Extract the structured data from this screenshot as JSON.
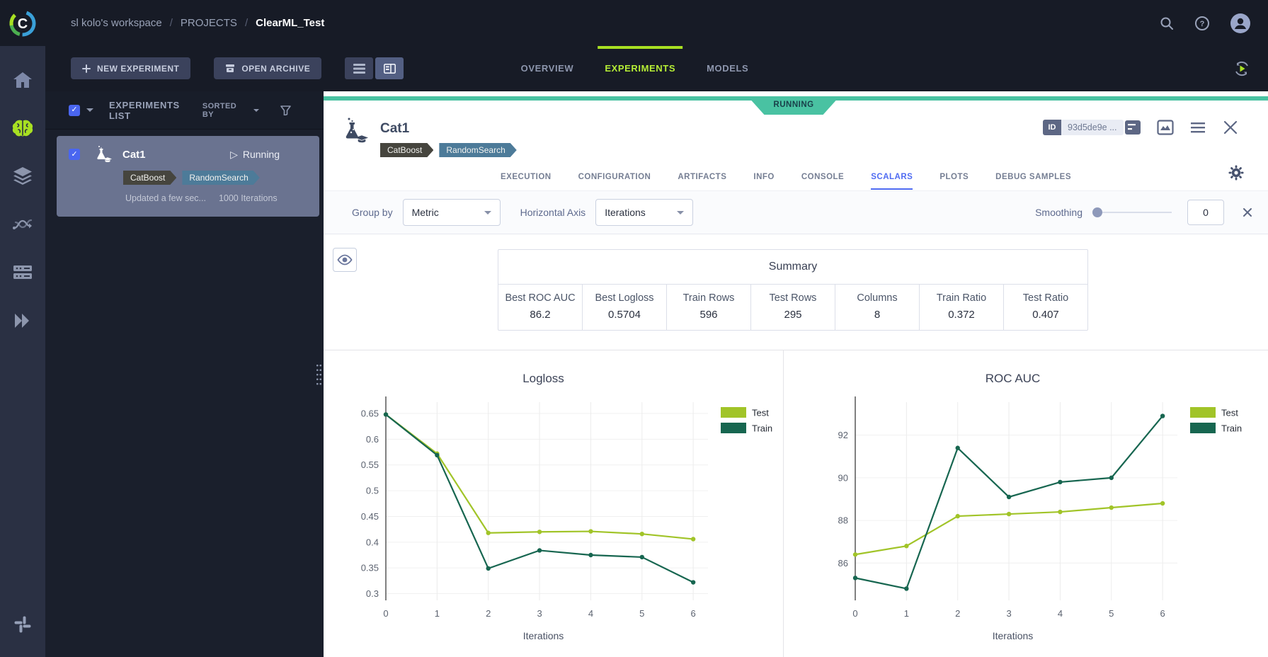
{
  "topbar": {
    "breadcrumb": [
      "sl kolo's workspace",
      "PROJECTS",
      "ClearML_Test"
    ],
    "separator": "/"
  },
  "subbar": {
    "new_experiment": "NEW EXPERIMENT",
    "open_archive": "OPEN ARCHIVE",
    "tabs": [
      "OVERVIEW",
      "EXPERIMENTS",
      "MODELS"
    ],
    "active_tab": "EXPERIMENTS"
  },
  "sidebar": {
    "icons": [
      "home",
      "projects",
      "datasets",
      "pipelines",
      "workers",
      "applications",
      "slack"
    ]
  },
  "experiments_panel": {
    "title": "EXPERIMENTS LIST",
    "sorted_by": "SORTED BY",
    "card": {
      "name": "Cat1",
      "status_icon": "▷",
      "status": "Running",
      "tags": [
        "CatBoost",
        "RandomSearch"
      ],
      "updated": "Updated a few sec...",
      "iterations": "1000 Iterations"
    }
  },
  "detail": {
    "ribbon": "RUNNING",
    "title": "Cat1",
    "tags": [
      "CatBoost",
      "RandomSearch"
    ],
    "id_label": "ID",
    "id_value": "93d5de9e ...",
    "tabs": [
      "EXECUTION",
      "CONFIGURATION",
      "ARTIFACTS",
      "INFO",
      "CONSOLE",
      "SCALARS",
      "PLOTS",
      "DEBUG SAMPLES"
    ],
    "active_tab": "SCALARS",
    "controls": {
      "group_by_label": "Group by",
      "group_by_value": "Metric",
      "horizontal_axis_label": "Horizontal Axis",
      "horizontal_axis_value": "Iterations",
      "smoothing_label": "Smoothing",
      "smoothing_value": "0"
    },
    "summary": {
      "title": "Summary",
      "metrics": [
        {
          "label": "Best ROC AUC",
          "value": "86.2"
        },
        {
          "label": "Best Logloss",
          "value": "0.5704"
        },
        {
          "label": "Train Rows",
          "value": "596"
        },
        {
          "label": "Test Rows",
          "value": "295"
        },
        {
          "label": "Columns",
          "value": "8"
        },
        {
          "label": "Train Ratio",
          "value": "0.372"
        },
        {
          "label": "Test Ratio",
          "value": "0.407"
        }
      ]
    }
  },
  "colors": {
    "accent_lime": "#a8e022",
    "running_teal": "#49c2a2",
    "active_blue": "#4f6bf2",
    "test_series": "#a1c428",
    "train_series": "#176650"
  },
  "chart_data": [
    {
      "type": "line",
      "title": "Logloss",
      "xlabel": "Iterations",
      "x": [
        0,
        1,
        2,
        3,
        4,
        5,
        6
      ],
      "xlim": [
        0,
        6.15
      ],
      "ylim": [
        0.287,
        0.672
      ],
      "yticks": [
        "0.3",
        "0.35",
        "0.4",
        "0.45",
        "0.5",
        "0.55",
        "0.6",
        "0.65"
      ],
      "grid": true,
      "legend_position": "top-right",
      "series": [
        {
          "name": "Test",
          "color": "#a1c428",
          "values": [
            0.648,
            0.572,
            0.418,
            0.42,
            0.421,
            0.416,
            0.406
          ]
        },
        {
          "name": "Train",
          "color": "#176650",
          "values": [
            0.648,
            0.569,
            0.349,
            0.384,
            0.375,
            0.371,
            0.322
          ]
        }
      ]
    },
    {
      "type": "line",
      "title": "ROC AUC",
      "xlabel": "Iterations",
      "x": [
        0,
        1,
        2,
        3,
        4,
        5,
        6
      ],
      "xlim": [
        0,
        6.15
      ],
      "ylim": [
        84.25,
        93.55
      ],
      "yticks": [
        "86",
        "88",
        "90",
        "92"
      ],
      "grid": true,
      "legend_position": "top-right",
      "series": [
        {
          "name": "Test",
          "color": "#a1c428",
          "values": [
            86.4,
            86.8,
            88.2,
            88.3,
            88.4,
            88.6,
            88.8
          ]
        },
        {
          "name": "Train",
          "color": "#176650",
          "values": [
            85.3,
            84.8,
            91.4,
            89.1,
            89.8,
            90.0,
            92.9
          ]
        }
      ]
    }
  ]
}
